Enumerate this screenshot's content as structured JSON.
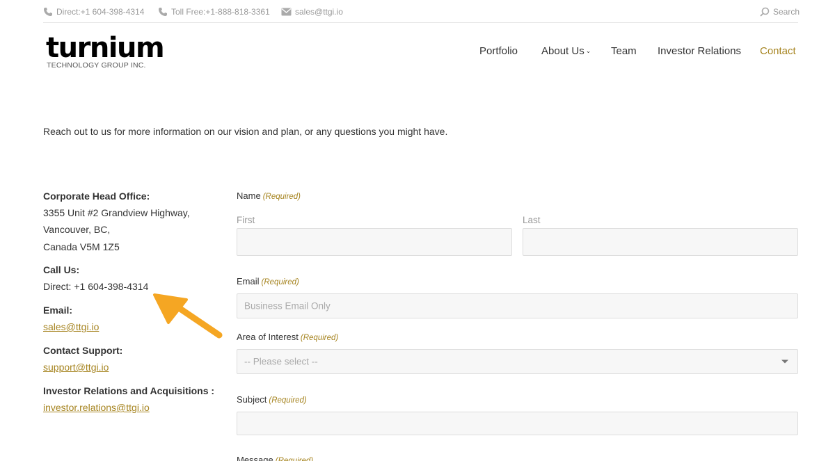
{
  "topbar": {
    "direct": "Direct:+1 604-398-4314",
    "tollfree": "Toll Free:+1-888-818-3361",
    "email": "sales@ttgi.io",
    "search": "Search"
  },
  "logo": {
    "name": "turnium",
    "tagline": "TECHNOLOGY GROUP INC."
  },
  "nav": {
    "portfolio": "Portfolio",
    "about": "About Us",
    "team": "Team",
    "investor": "Investor Relations",
    "contact": "Contact"
  },
  "intro": "Reach out to us for more information on our vision and plan, or any questions you might have.",
  "contact_info": {
    "office_heading": "Corporate Head Office:",
    "address_line1": "3355 Unit #2 Grandview Highway,",
    "address_line2": "Vancouver, BC,",
    "address_line3": "Canada V5M 1Z5",
    "call_heading": "Call Us:",
    "call_direct": "Direct: +1 604-398-4314",
    "email_heading": "Email:",
    "email_link": "sales@ttgi.io",
    "support_heading": "Contact Support:",
    "support_link": "support@ttgi.io",
    "investor_heading": "Investor Relations and Acquisitions :",
    "investor_link": "investor.relations@ttgi.io"
  },
  "form": {
    "required": "(Required)",
    "name_label": "Name",
    "first_label": "First",
    "last_label": "Last",
    "email_label": "Email",
    "email_placeholder": "Business Email Only",
    "interest_label": "Area of Interest",
    "interest_selected": "-- Please select --",
    "subject_label": "Subject",
    "message_label": "Message"
  },
  "colors": {
    "accent": "#a68420",
    "annotation_arrow": "#f5a623"
  }
}
